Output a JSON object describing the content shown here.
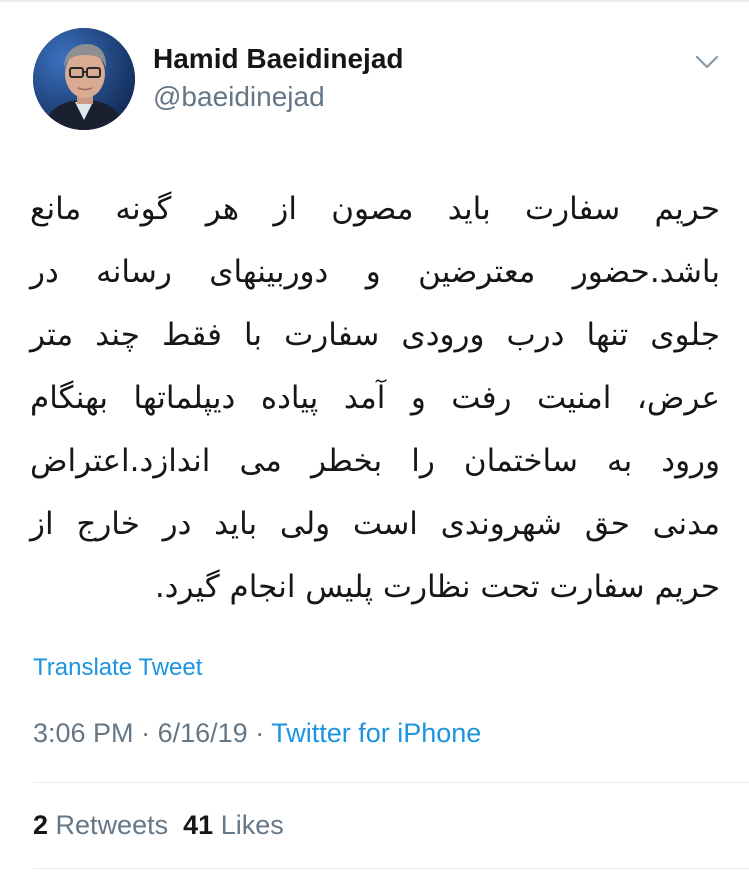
{
  "user": {
    "name": "Hamid Baeidinejad",
    "handle": "@baeidinejad",
    "avatar_icon": "profile-photo"
  },
  "menu": {
    "icon": "chevron-down-icon"
  },
  "tweet": {
    "lines": [
      "حریم سفارت باید مصون از هر گونه مانع",
      "باشد.حضور معترضین و دوربینهای رسانه در",
      "جلوی تنها درب ورودی سفارت با فقط چند متر",
      "عرض، امنیت رفت و آمد پیاده دیپلماتها بهنگام",
      "ورود به ساختمان را بخطر می اندازد.اعتراض",
      "مدنی حق شهروندی است ولی باید در خارج از",
      "حریم سفارت تحت نظارت پلیس انجام گیرد."
    ],
    "translate_label": "Translate Tweet",
    "time": "3:06 PM",
    "date": "6/16/19",
    "separator": "·",
    "source": "Twitter for iPhone"
  },
  "stats": {
    "retweets_count": "2",
    "retweets_label": "Retweets",
    "likes_count": "41",
    "likes_label": "Likes"
  },
  "colors": {
    "link": "#1b95e0",
    "secondary": "#657786",
    "text": "#14171a",
    "border": "#e6ecf0"
  }
}
